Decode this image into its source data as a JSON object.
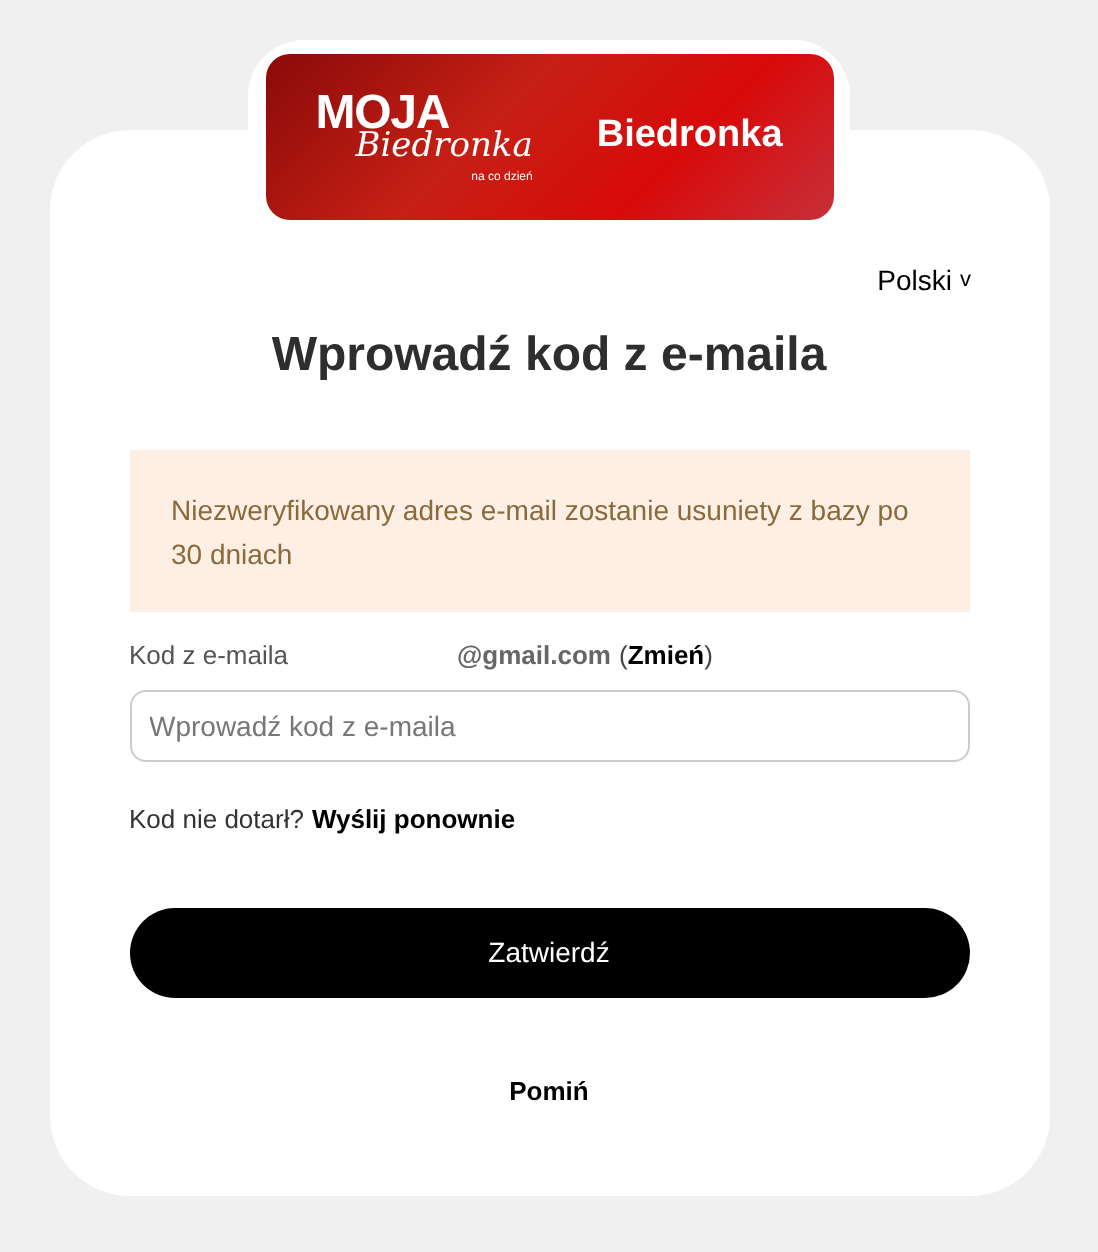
{
  "logo": {
    "brand": "MOJA",
    "script": "Biedronka",
    "tagline": "na co dzień",
    "name": "Biedronka"
  },
  "language": {
    "label": "Polski",
    "chevron": "v"
  },
  "title": "Wprowadź kod z e-maila",
  "notice": "Niezweryfikowany adres e-mail zostanie usuniety z bazy po 30 dniach",
  "code_field": {
    "label": "Kod z e-maila",
    "email": "@gmail.com",
    "open_paren": "(",
    "change_link": "Zmień",
    "close_paren": ")",
    "placeholder": "Wprowadź kod z e-maila"
  },
  "resend": {
    "question": "Kod nie dotarł?",
    "link": "Wyślij ponownie"
  },
  "submit": "Zatwierdź",
  "skip": "Pomiń"
}
